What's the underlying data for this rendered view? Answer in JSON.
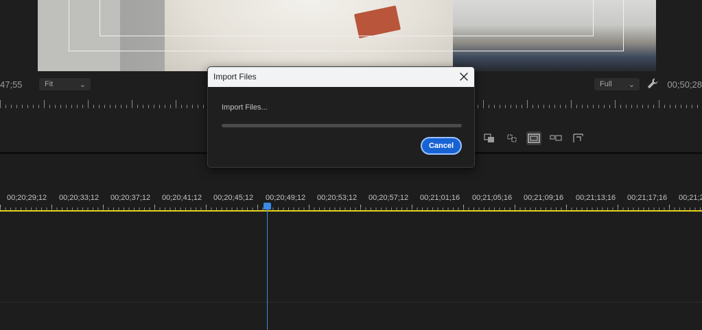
{
  "program_monitor": {
    "timecode_left": "47;55",
    "timecode_right": "00;50;28",
    "zoom_select": {
      "value": "Fit"
    },
    "resolution_select": {
      "value": "Full"
    }
  },
  "timeline": {
    "timecodes": [
      "00;20;29;12",
      "00;20;33;12",
      "00;20;37;12",
      "00;20;41;12",
      "00;20;45;12",
      "00;20;49;12",
      "00;20;53;12",
      "00;20;57;12",
      "00;21;01;16",
      "00;21;05;16",
      "00;21;09;16",
      "00;21;13;16",
      "00;21;17;16",
      "00;21;2"
    ]
  },
  "dialog": {
    "title": "Import Files",
    "message": "Import Files...",
    "progress": 0.0,
    "cancel_label": "Cancel"
  },
  "colors": {
    "accent_blue": "#1863d4",
    "playhead": "#3b8be6",
    "work_area": "#e4d21a"
  }
}
